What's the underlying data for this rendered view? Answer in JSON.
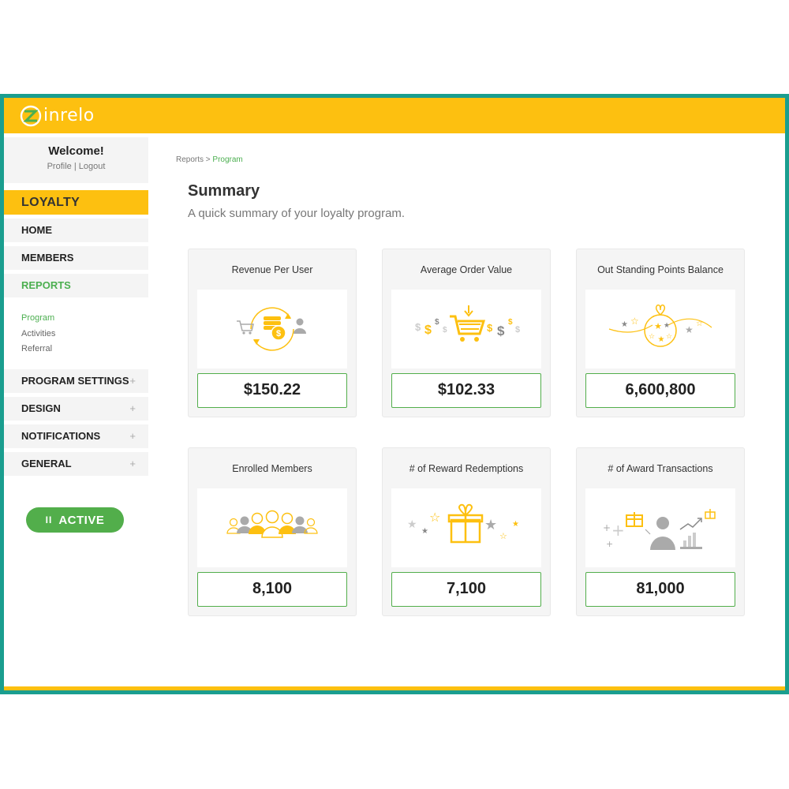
{
  "app": {
    "logo_text": "inrelo"
  },
  "sidebar": {
    "welcome": "Welcome!",
    "profile_link": "Profile",
    "separator": "|",
    "logout_link": "Logout",
    "section_title": "LOYALTY",
    "nav": {
      "home": "HOME",
      "members": "MEMBERS",
      "reports": "REPORTS",
      "program_settings": "PROGRAM SETTINGS",
      "design": "DESIGN",
      "notifications": "NOTIFICATIONS",
      "general": "GENERAL"
    },
    "subnav": [
      "Program",
      "Activities",
      "Referral"
    ],
    "expand_symbol": "+",
    "status_button": "ACTIVE",
    "status_icon": "II"
  },
  "breadcrumb": {
    "parent": "Reports",
    "separator": ">",
    "current": "Program"
  },
  "header": {
    "title": "Summary",
    "subtitle": "A quick summary of your loyalty program."
  },
  "cards": [
    {
      "label": "Revenue Per User",
      "value": "$150.22",
      "icon": "revenue-cycle-icon"
    },
    {
      "label": "Average Order Value",
      "value": "$102.33",
      "icon": "cart-dollars-icon"
    },
    {
      "label": "Out Standing Points Balance",
      "value": "6,600,800",
      "icon": "points-bag-icon"
    },
    {
      "label": "Enrolled Members",
      "value": "8,100",
      "icon": "members-group-icon"
    },
    {
      "label": "# of Reward Redemptions",
      "value": "7,100",
      "icon": "gift-stars-icon"
    },
    {
      "label": "# of Award Transactions",
      "value": "81,000",
      "icon": "award-transactions-icon"
    }
  ],
  "colors": {
    "brand_yellow": "#fdc010",
    "frame_teal": "#1a9e8f",
    "accent_green": "#52ae4b"
  }
}
